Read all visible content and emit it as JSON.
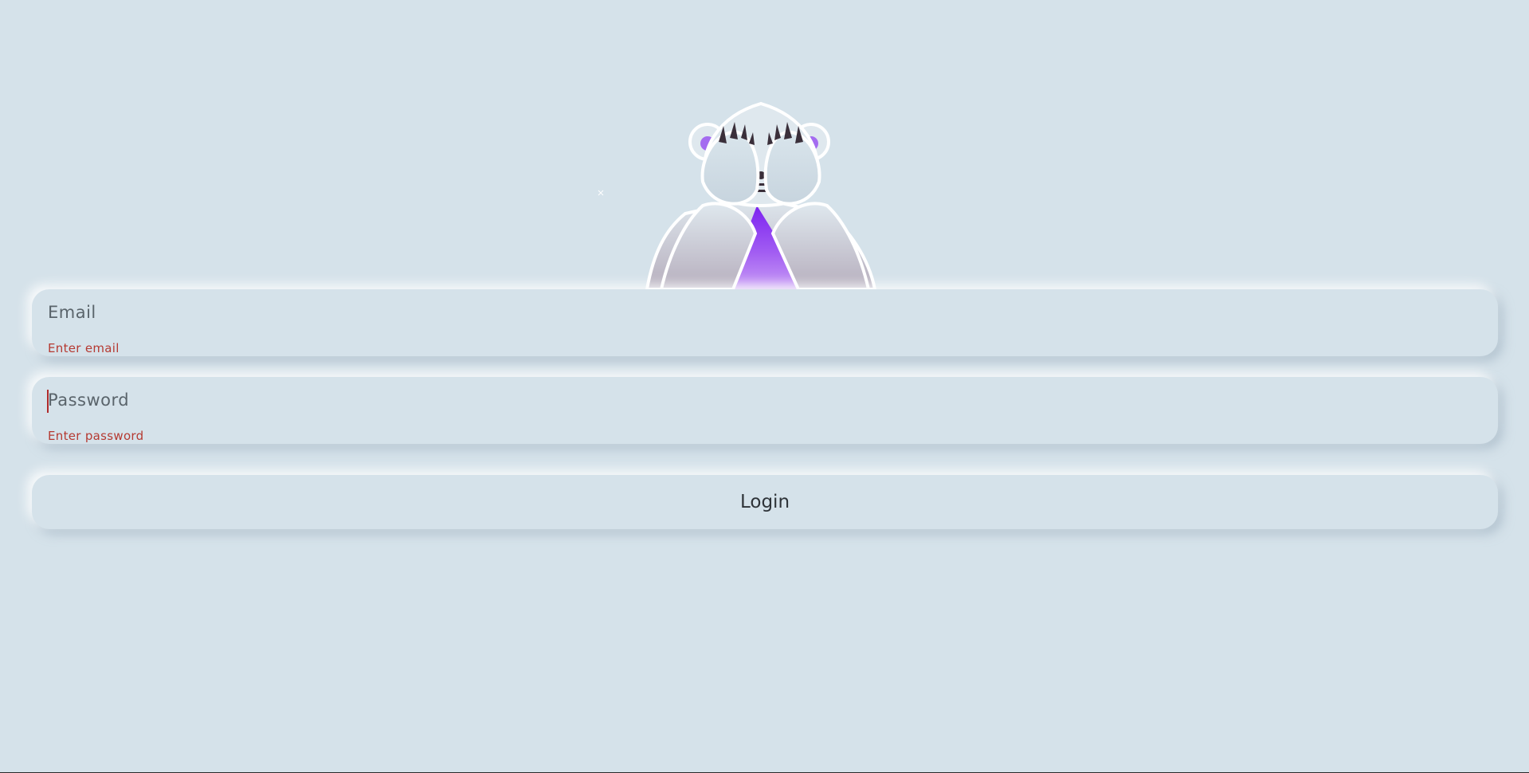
{
  "form": {
    "email": {
      "value": "",
      "placeholder": "Email",
      "error": "Enter email"
    },
    "password": {
      "value": "",
      "placeholder": "Password",
      "error": "Enter password"
    },
    "login_label": "Login"
  },
  "mascot": {
    "icon": "bear-covering-eyes-icon"
  },
  "colors": {
    "background": "#d5e2ea",
    "error": "#b53a32",
    "accent_purple": "#9333ea",
    "text": "#2e3338"
  }
}
